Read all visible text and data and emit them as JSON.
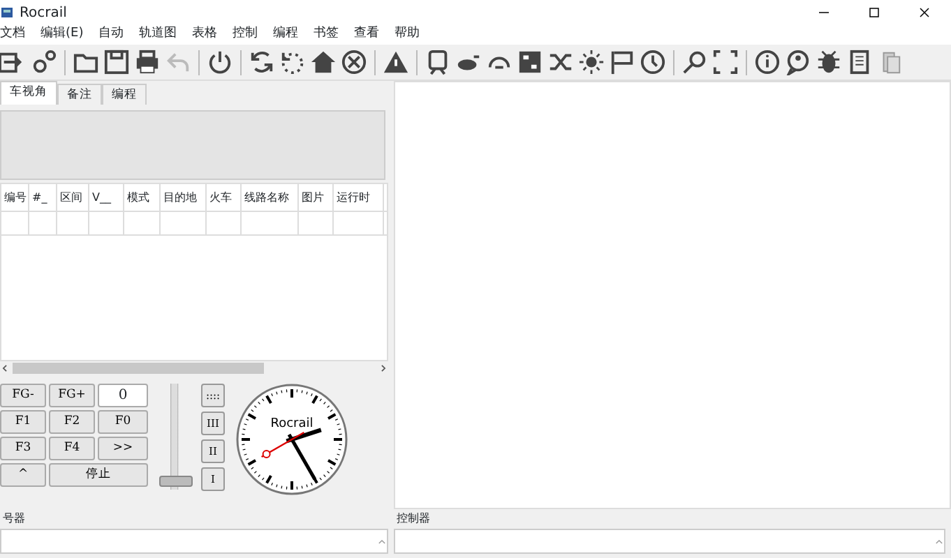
{
  "window": {
    "title": "Rocrail"
  },
  "menu": [
    "文档",
    "编辑(E)",
    "自动",
    "轨道图",
    "表格",
    "控制",
    "编程",
    "书签",
    "查看",
    "帮助"
  ],
  "tabs": [
    {
      "label": "车视角",
      "selected": true
    },
    {
      "label": "备注",
      "selected": false
    },
    {
      "label": "编程",
      "selected": false
    }
  ],
  "table": {
    "columns": [
      "编号",
      "#_",
      "区间",
      "V__",
      "模式",
      "目的地",
      "火车",
      "线路名称",
      "图片",
      "运行时"
    ]
  },
  "throttle": {
    "rows": [
      [
        {
          "label": "FG-"
        },
        {
          "label": "FG+"
        },
        {
          "kind": "field",
          "value": "0"
        }
      ],
      [
        {
          "label": "F1"
        },
        {
          "label": "F2"
        },
        {
          "label": "F0"
        }
      ],
      [
        {
          "label": "F3"
        },
        {
          "label": "F4"
        },
        {
          "label": ">>"
        }
      ],
      [
        {
          "label": "^"
        },
        {
          "label": "停止",
          "wide": true
        }
      ]
    ],
    "speed": {
      "level": 0
    },
    "steps": [
      "::::",
      "III",
      "II",
      "I"
    ],
    "clock": {
      "brand": "Rocrail"
    }
  },
  "panels": [
    {
      "title": "号器"
    },
    {
      "title": "控制器"
    }
  ]
}
